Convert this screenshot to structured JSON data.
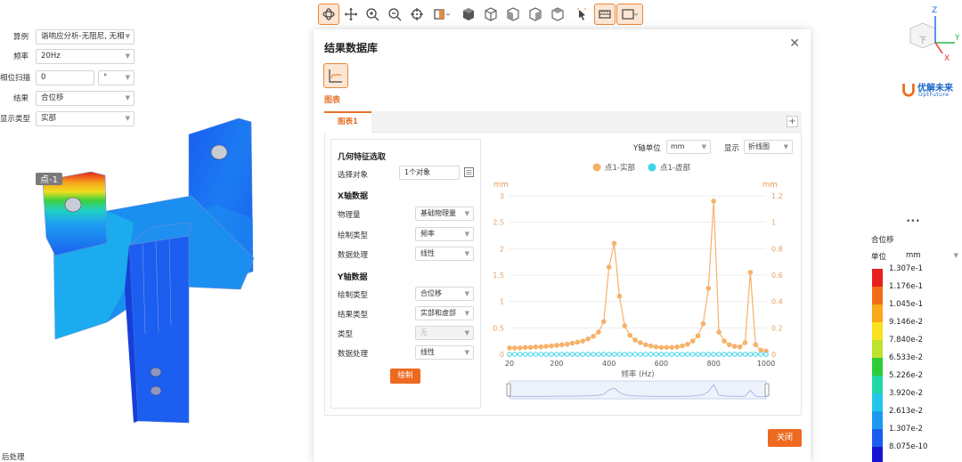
{
  "left_panel": {
    "rows": [
      {
        "label": "算例",
        "value": "谐响应分析-无阻尼, 无相"
      },
      {
        "label": "频率",
        "value": "20Hz"
      },
      {
        "label": "相位扫描",
        "value": "0",
        "unit": "°"
      },
      {
        "label": "结果",
        "value": "合位移"
      },
      {
        "label": "显示类型",
        "value": "实部"
      }
    ],
    "point_label": "点-1",
    "bottom_text": "后处理"
  },
  "toolbar": {
    "icons": [
      "rotate-icon",
      "pan-icon",
      "zoom-in-icon",
      "zoom-out-icon",
      "target-icon",
      "section-icon",
      "cube-solid-icon",
      "cube-front-icon",
      "cube-side-icon",
      "cube-top-icon",
      "cube-iso-icon",
      "select-icon",
      "measure-icon",
      "display-icon"
    ]
  },
  "modal": {
    "title": "结果数据库",
    "chart_tool_label": "图表",
    "tab_label": "图表1",
    "tab_add": "+",
    "geom_section": "几何特征选取",
    "select_obj_label": "选择对象",
    "select_obj_value": "1个对象",
    "x_section": "X轴数据",
    "x_rows": [
      {
        "label": "物理量",
        "value": "基础物理量"
      },
      {
        "label": "绘制类型",
        "value": "频率"
      },
      {
        "label": "数据处理",
        "value": "线性"
      }
    ],
    "y_section": "Y轴数据",
    "y_rows": [
      {
        "label": "绘制类型",
        "value": "合位移"
      },
      {
        "label": "结果类型",
        "value": "实部和虚部"
      },
      {
        "label": "类型",
        "value": "无"
      },
      {
        "label": "数据处理",
        "value": "线性"
      }
    ],
    "draw_button": "绘制",
    "y_unit_label": "Y轴单位",
    "y_unit_value": "mm",
    "display_label": "显示",
    "display_value": "折线图",
    "close_button": "关闭"
  },
  "chart_data": {
    "type": "line",
    "xlabel": "频率 (Hz)",
    "ylabel_left": "mm",
    "ylabel_right": "mm",
    "xlim": [
      20,
      1000
    ],
    "ylim_left": [
      0,
      3
    ],
    "ylim_right": [
      0,
      1.2
    ],
    "xticks": [
      20,
      200,
      400,
      600,
      800,
      1000
    ],
    "yticks_left": [
      0,
      0.5,
      1,
      1.5,
      2,
      2.5,
      3
    ],
    "yticks_right": [
      0,
      0.2,
      0.4,
      0.6,
      0.8,
      1,
      1.2
    ],
    "legend_position": "top-center",
    "x": [
      20,
      40,
      60,
      80,
      100,
      120,
      140,
      160,
      180,
      200,
      220,
      240,
      260,
      280,
      300,
      320,
      340,
      360,
      380,
      400,
      420,
      440,
      460,
      480,
      500,
      520,
      540,
      560,
      580,
      600,
      620,
      640,
      660,
      680,
      700,
      720,
      740,
      760,
      780,
      800,
      820,
      840,
      860,
      880,
      900,
      920,
      940,
      960,
      980,
      1000
    ],
    "series": [
      {
        "name": "点1-实部",
        "color": "#f5b26b",
        "values": [
          0.12,
          0.12,
          0.12,
          0.13,
          0.13,
          0.14,
          0.14,
          0.15,
          0.16,
          0.17,
          0.18,
          0.19,
          0.21,
          0.23,
          0.25,
          0.29,
          0.34,
          0.42,
          0.62,
          1.65,
          2.1,
          1.1,
          0.54,
          0.36,
          0.27,
          0.22,
          0.18,
          0.16,
          0.14,
          0.13,
          0.13,
          0.13,
          0.14,
          0.16,
          0.19,
          0.25,
          0.35,
          0.58,
          1.25,
          2.9,
          0.42,
          0.25,
          0.18,
          0.15,
          0.14,
          0.22,
          1.55,
          0.18,
          0.08,
          0.06
        ]
      },
      {
        "name": "点1-虚部",
        "color": "#3ed4e8",
        "values": [
          0,
          0,
          0,
          0,
          0,
          0,
          0,
          0,
          0,
          0,
          0,
          0,
          0,
          0,
          0,
          0,
          0,
          0,
          0,
          0,
          0,
          0,
          0,
          0,
          0,
          0,
          0,
          0,
          0,
          0,
          0,
          0,
          0,
          0,
          0,
          0,
          0,
          0,
          0,
          0,
          0,
          0,
          0,
          0,
          0,
          0,
          0,
          0,
          0,
          0
        ]
      }
    ]
  },
  "colorbar": {
    "menu_icon": "•••",
    "title": "合位移",
    "unit_label": "单位",
    "unit_value": "mm",
    "values": [
      "1.307e-1",
      "1.176e-1",
      "1.045e-1",
      "9.146e-2",
      "7.840e-2",
      "6.533e-2",
      "5.226e-2",
      "3.920e-2",
      "2.613e-2",
      "1.307e-2",
      "8.075e-10"
    ],
    "colors": [
      "#e8211e",
      "#f26d19",
      "#f9a81b",
      "#f9e11f",
      "#bfe22d",
      "#2dcd3a",
      "#22d7a6",
      "#22c6ea",
      "#1b98f0",
      "#1a5df0",
      "#1814d6"
    ]
  },
  "logo": {
    "brand_text": "优解未来",
    "brand_sub": "OptFuture",
    "axis_x": "X",
    "axis_y": "Y",
    "axis_z": "Z",
    "cube_face": "下"
  }
}
